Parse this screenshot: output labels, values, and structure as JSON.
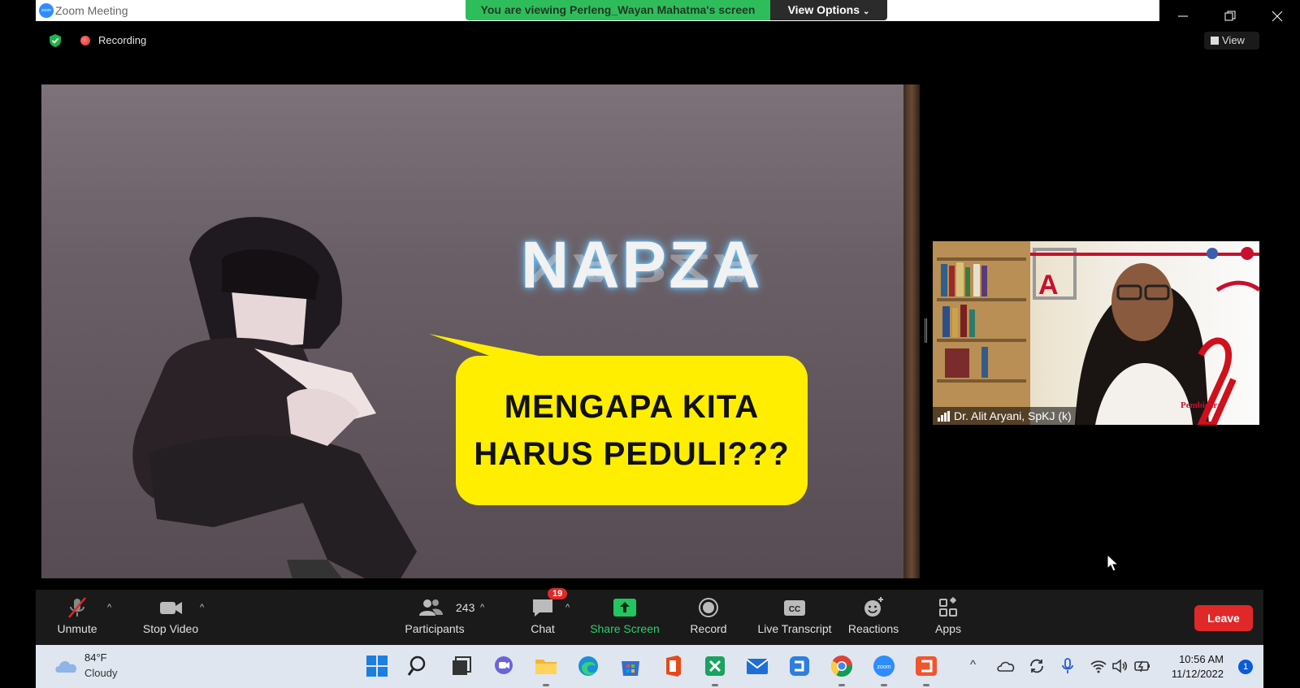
{
  "window": {
    "app_logo_text": "zoom",
    "title": "Zoom Meeting",
    "share_banner": "You are viewing Perleng_Wayan Mahatma's screen",
    "view_options": "View Options"
  },
  "status": {
    "recording_label": "Recording",
    "view_label": "View"
  },
  "slide": {
    "title": "NAPZA",
    "bubble_line1": "MENGAPA KITA",
    "bubble_line2": "HARUS PEDULI???"
  },
  "speaker": {
    "name": "Dr. Alit Aryani, SpKJ (k)",
    "banner_text": "Pembicara"
  },
  "toolbar": {
    "unmute": "Unmute",
    "stop_video": "Stop Video",
    "participants_count": "243",
    "participants": "Participants",
    "chat_badge": "19",
    "chat": "Chat",
    "share_screen": "Share Screen",
    "record": "Record",
    "live_transcript": "Live Transcript",
    "reactions": "Reactions",
    "apps": "Apps",
    "leave": "Leave"
  },
  "taskbar": {
    "weather_temp": "84°F",
    "weather_desc": "Cloudy",
    "time": "10:56 AM",
    "date": "11/12/2022",
    "notification_count": "1"
  }
}
